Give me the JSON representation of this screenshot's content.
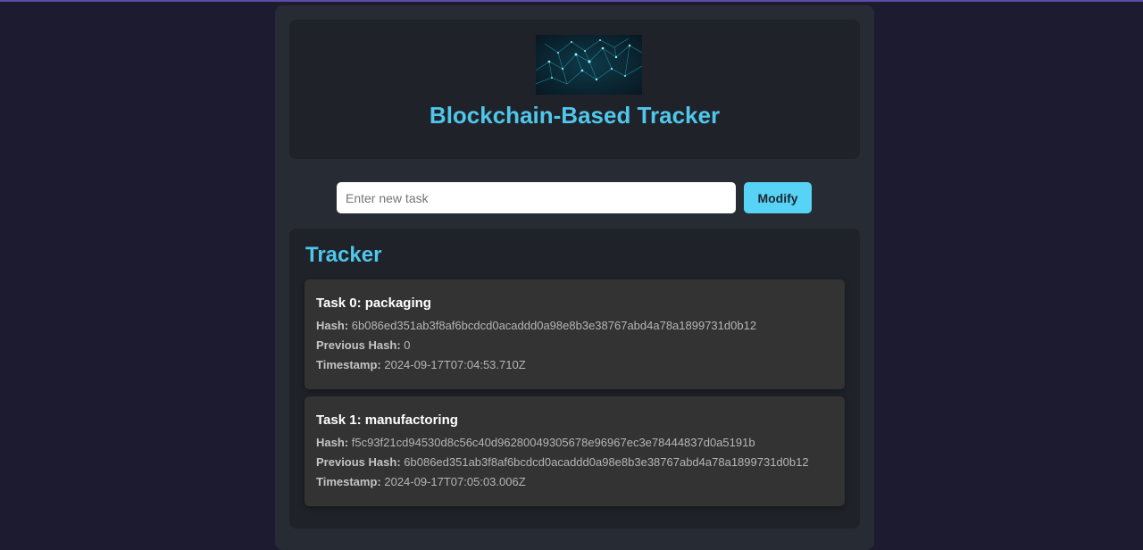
{
  "header": {
    "title": "Blockchain-Based Tracker",
    "logo_icon": "network-mesh-icon"
  },
  "form": {
    "placeholder": "Enter new task",
    "value": "",
    "button_label": "Modify"
  },
  "tracker": {
    "title": "Tracker",
    "labels": {
      "hash": "Hash:",
      "previous_hash": "Previous Hash:",
      "timestamp": "Timestamp:"
    },
    "blocks": [
      {
        "title": "Task 0: packaging",
        "hash": "6b086ed351ab3f8af6bcdcd0acaddd0a98e8b3e38767abd4a78a1899731d0b12",
        "previous_hash": "0",
        "timestamp": "2024-09-17T07:04:53.710Z"
      },
      {
        "title": "Task 1: manufactoring",
        "hash": "f5c93f21cd94530d8c56c40d96280049305678e96967ec3e78444837d0a5191b",
        "previous_hash": "6b086ed351ab3f8af6bcdcd0acaddd0a98e8b3e38767abd4a78a1899731d0b12",
        "timestamp": "2024-09-17T07:05:03.006Z"
      }
    ]
  },
  "colors": {
    "accent": "#4fc6ea",
    "button": "#57d3f6",
    "page_bg": "#1d1b30",
    "panel_bg": "#272b33",
    "card_bg": "#1f2229",
    "block_bg": "#333333"
  }
}
